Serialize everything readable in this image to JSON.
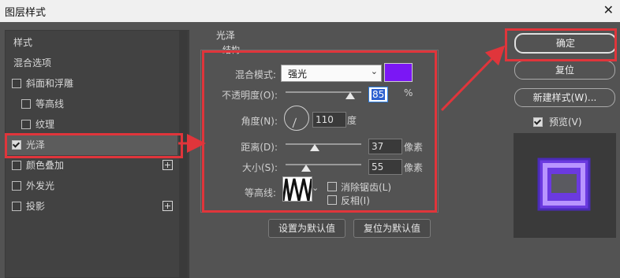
{
  "window": {
    "title": "图层样式",
    "close_symbol": "✕"
  },
  "sidebar": {
    "items": [
      {
        "label": "样式",
        "checkbox": false
      },
      {
        "label": "混合选项",
        "checkbox": false
      },
      {
        "label": "斜面和浮雕",
        "checkbox": true,
        "checked": false
      },
      {
        "label": "等高线",
        "checkbox": true,
        "checked": false
      },
      {
        "label": "纹理",
        "checkbox": true,
        "checked": false
      },
      {
        "label": "光泽",
        "checkbox": true,
        "checked": true,
        "selected": true
      },
      {
        "label": "颜色叠加",
        "checkbox": true,
        "checked": false,
        "plus": true
      },
      {
        "label": "外发光",
        "checkbox": true,
        "checked": false
      },
      {
        "label": "投影",
        "checkbox": true,
        "checked": false,
        "plus": true
      }
    ]
  },
  "satin": {
    "group_title": "光泽",
    "structure_title": "结构",
    "blend_mode_label": "混合模式:",
    "blend_mode_value": "强光",
    "blend_color": "#7b17f5",
    "opacity_label": "不透明度(O):",
    "opacity_value": "85",
    "opacity_unit": "%",
    "angle_label": "角度(N):",
    "angle_value": "110",
    "angle_unit": "度",
    "distance_label": "距离(D):",
    "distance_value": "37",
    "distance_unit": "像素",
    "size_label": "大小(S):",
    "size_value": "55",
    "size_unit": "像素",
    "contour_label": "等高线:",
    "anti_alias_label": "消除锯齿(L)",
    "invert_label": "反相(I)",
    "default_button": "设置为默认值",
    "reset_button": "复位为默认值"
  },
  "actions": {
    "ok": "确定",
    "reset": "复位",
    "new_style": "新建样式(W)...",
    "preview_label": "预览(V)",
    "preview_checked": true
  },
  "colors": {
    "highlight": "#e0353b",
    "panel": "#535353",
    "sidebar": "#424242"
  }
}
